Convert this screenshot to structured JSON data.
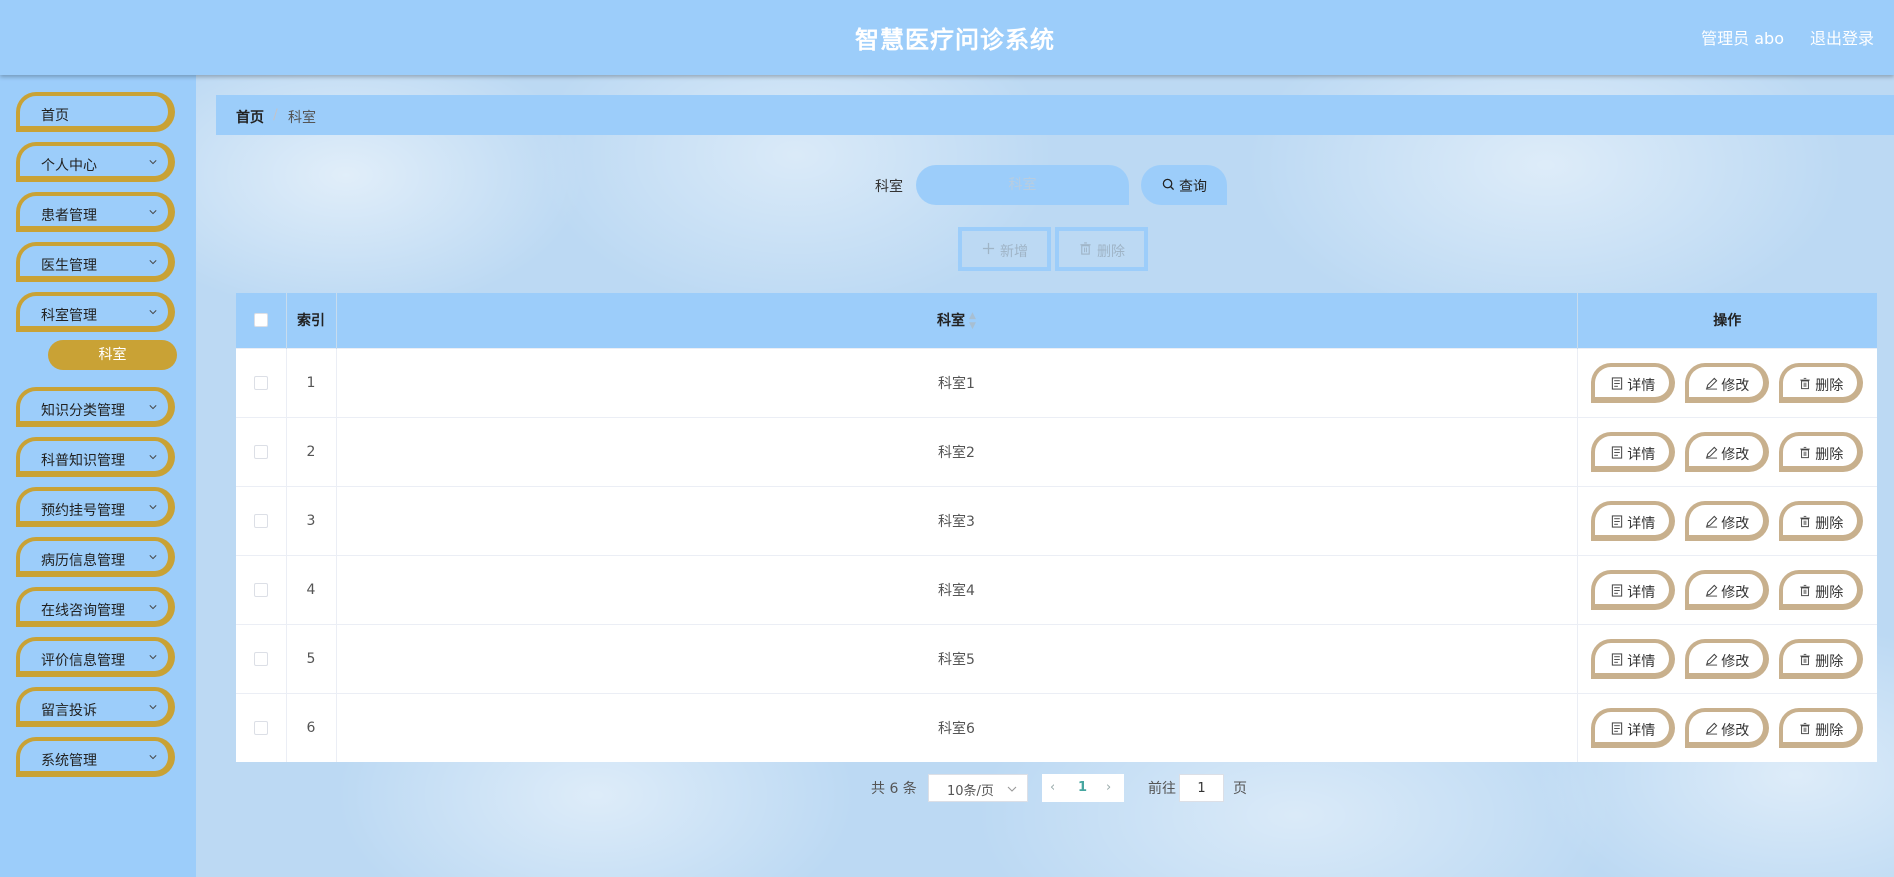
{
  "header": {
    "title": "智慧医疗问诊系统",
    "user": "管理员 abo",
    "logout": "退出登录"
  },
  "sidebar": {
    "items": [
      {
        "label": "首页",
        "has_chevron": false
      },
      {
        "label": "个人中心",
        "has_chevron": true
      },
      {
        "label": "患者管理",
        "has_chevron": true
      },
      {
        "label": "医生管理",
        "has_chevron": true
      },
      {
        "label": "科室管理",
        "has_chevron": true,
        "expanded": true
      },
      {
        "label": "知识分类管理",
        "has_chevron": true
      },
      {
        "label": "科普知识管理",
        "has_chevron": true
      },
      {
        "label": "预约挂号管理",
        "has_chevron": true
      },
      {
        "label": "病历信息管理",
        "has_chevron": true
      },
      {
        "label": "在线咨询管理",
        "has_chevron": true
      },
      {
        "label": "评价信息管理",
        "has_chevron": true
      },
      {
        "label": "留言投诉",
        "has_chevron": true
      },
      {
        "label": "系统管理",
        "has_chevron": true
      }
    ],
    "active_sub": "科室"
  },
  "breadcrumb": {
    "home": "首页",
    "separator": "/",
    "current": "科室"
  },
  "search": {
    "label": "科室",
    "placeholder": "科室",
    "button": "查询"
  },
  "toolbar": {
    "add": "新增",
    "delete": "删除"
  },
  "table": {
    "headers": {
      "index": "索引",
      "name": "科室",
      "ops": "操作"
    },
    "rows": [
      {
        "index": "1",
        "name": "科室1"
      },
      {
        "index": "2",
        "name": "科室2"
      },
      {
        "index": "3",
        "name": "科室3"
      },
      {
        "index": "4",
        "name": "科室4"
      },
      {
        "index": "5",
        "name": "科室5"
      },
      {
        "index": "6",
        "name": "科室6"
      }
    ],
    "actions": {
      "detail": "详情",
      "edit": "修改",
      "delete": "删除"
    }
  },
  "pagination": {
    "total": "共 6 条",
    "page_size": "10条/页",
    "current_page": "1",
    "goto_label": "前往",
    "goto_value": "1",
    "page_suffix": "页"
  },
  "colors": {
    "header_bg": "#9ccdfa",
    "menu_border": "#c9a235",
    "active_sub_bg": "#c9a235",
    "op_border": "#c8b08d",
    "pager_active": "#46a6a0"
  },
  "icons": {
    "chevron": "chevron-down-icon",
    "search": "search-icon",
    "add": "plus-icon",
    "delete": "trash-icon",
    "detail": "document-icon",
    "edit": "pencil-icon"
  }
}
